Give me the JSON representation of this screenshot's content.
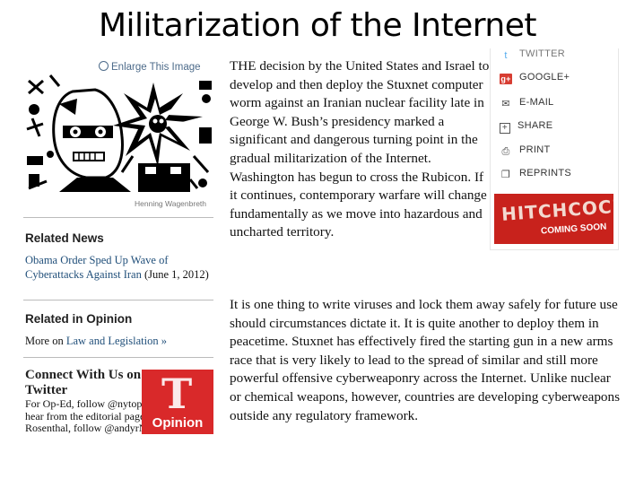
{
  "slide_title": "Militarization of the Internet",
  "enlarge_link": "Enlarge This Image",
  "image_credit": "Henning Wagenbreth",
  "related_news": {
    "heading": "Related News",
    "link": "Obama Order Sped Up Wave of Cyberattacks Against Iran",
    "date": " (June 1, 2012)"
  },
  "related_opinion": {
    "heading": "Related in Opinion",
    "prefix": "More on ",
    "link": "Law and Legislation »"
  },
  "twitter": {
    "heading": "Connect With Us on Twitter",
    "body": "For Op-Ed, follow @nytopinion and to hear from the editorial page editor, Andrew Rosenthal, follow @andyrNYT."
  },
  "opinion_logo": "Opinion",
  "share_menu": [
    {
      "label": "TWITTER",
      "icon": "twitter-icon"
    },
    {
      "label": "GOOGLE+",
      "icon": "google-plus-icon"
    },
    {
      "label": "E-MAIL",
      "icon": "email-icon"
    },
    {
      "label": "SHARE",
      "icon": "share-icon"
    },
    {
      "label": "PRINT",
      "icon": "print-icon"
    },
    {
      "label": "REPRINTS",
      "icon": "reprints-icon"
    }
  ],
  "ad": {
    "title": "HITCHCOCK",
    "subtitle": "COMING SOON"
  },
  "article": {
    "p1": "THE decision by the United States and Israel to develop and then deploy the Stuxnet computer worm against an Iranian nuclear facility late in George W. Bush’s presidency marked a significant and dangerous turning point in the gradual militarization of the Internet. Washington has begun to cross the Rubicon. If it continues, contemporary warfare will change fundamentally as we move into hazardous and uncharted territory.",
    "p2": "It is one thing to write viruses and lock them away safely for future use should circumstances dictate it. It is quite another to deploy them in peacetime. Stuxnet has effectively fired the starting gun in a new arms race that is very likely to lead to the spread of similar and still more powerful offensive cyberweaponry across the Internet. Unlike nuclear or chemical weapons, however, countries are developing cyberweapons outside any regulatory framework."
  }
}
